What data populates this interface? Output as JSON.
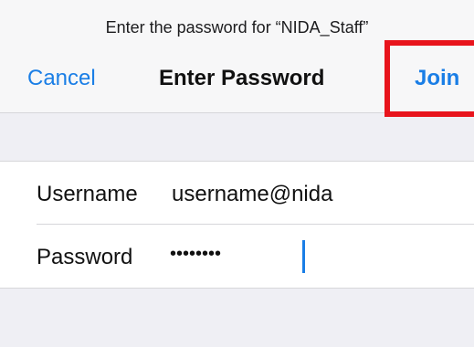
{
  "nav": {
    "prompt": "Enter the password for “NIDA_Staff”",
    "cancel_label": "Cancel",
    "title": "Enter Password",
    "join_label": "Join"
  },
  "form": {
    "username": {
      "label": "Username",
      "value": "username@nida"
    },
    "password": {
      "label": "Password",
      "masked_value": "••••••••"
    }
  },
  "colors": {
    "accent": "#1a7ee6",
    "highlight": "#e8141c",
    "background": "#efeff4"
  }
}
